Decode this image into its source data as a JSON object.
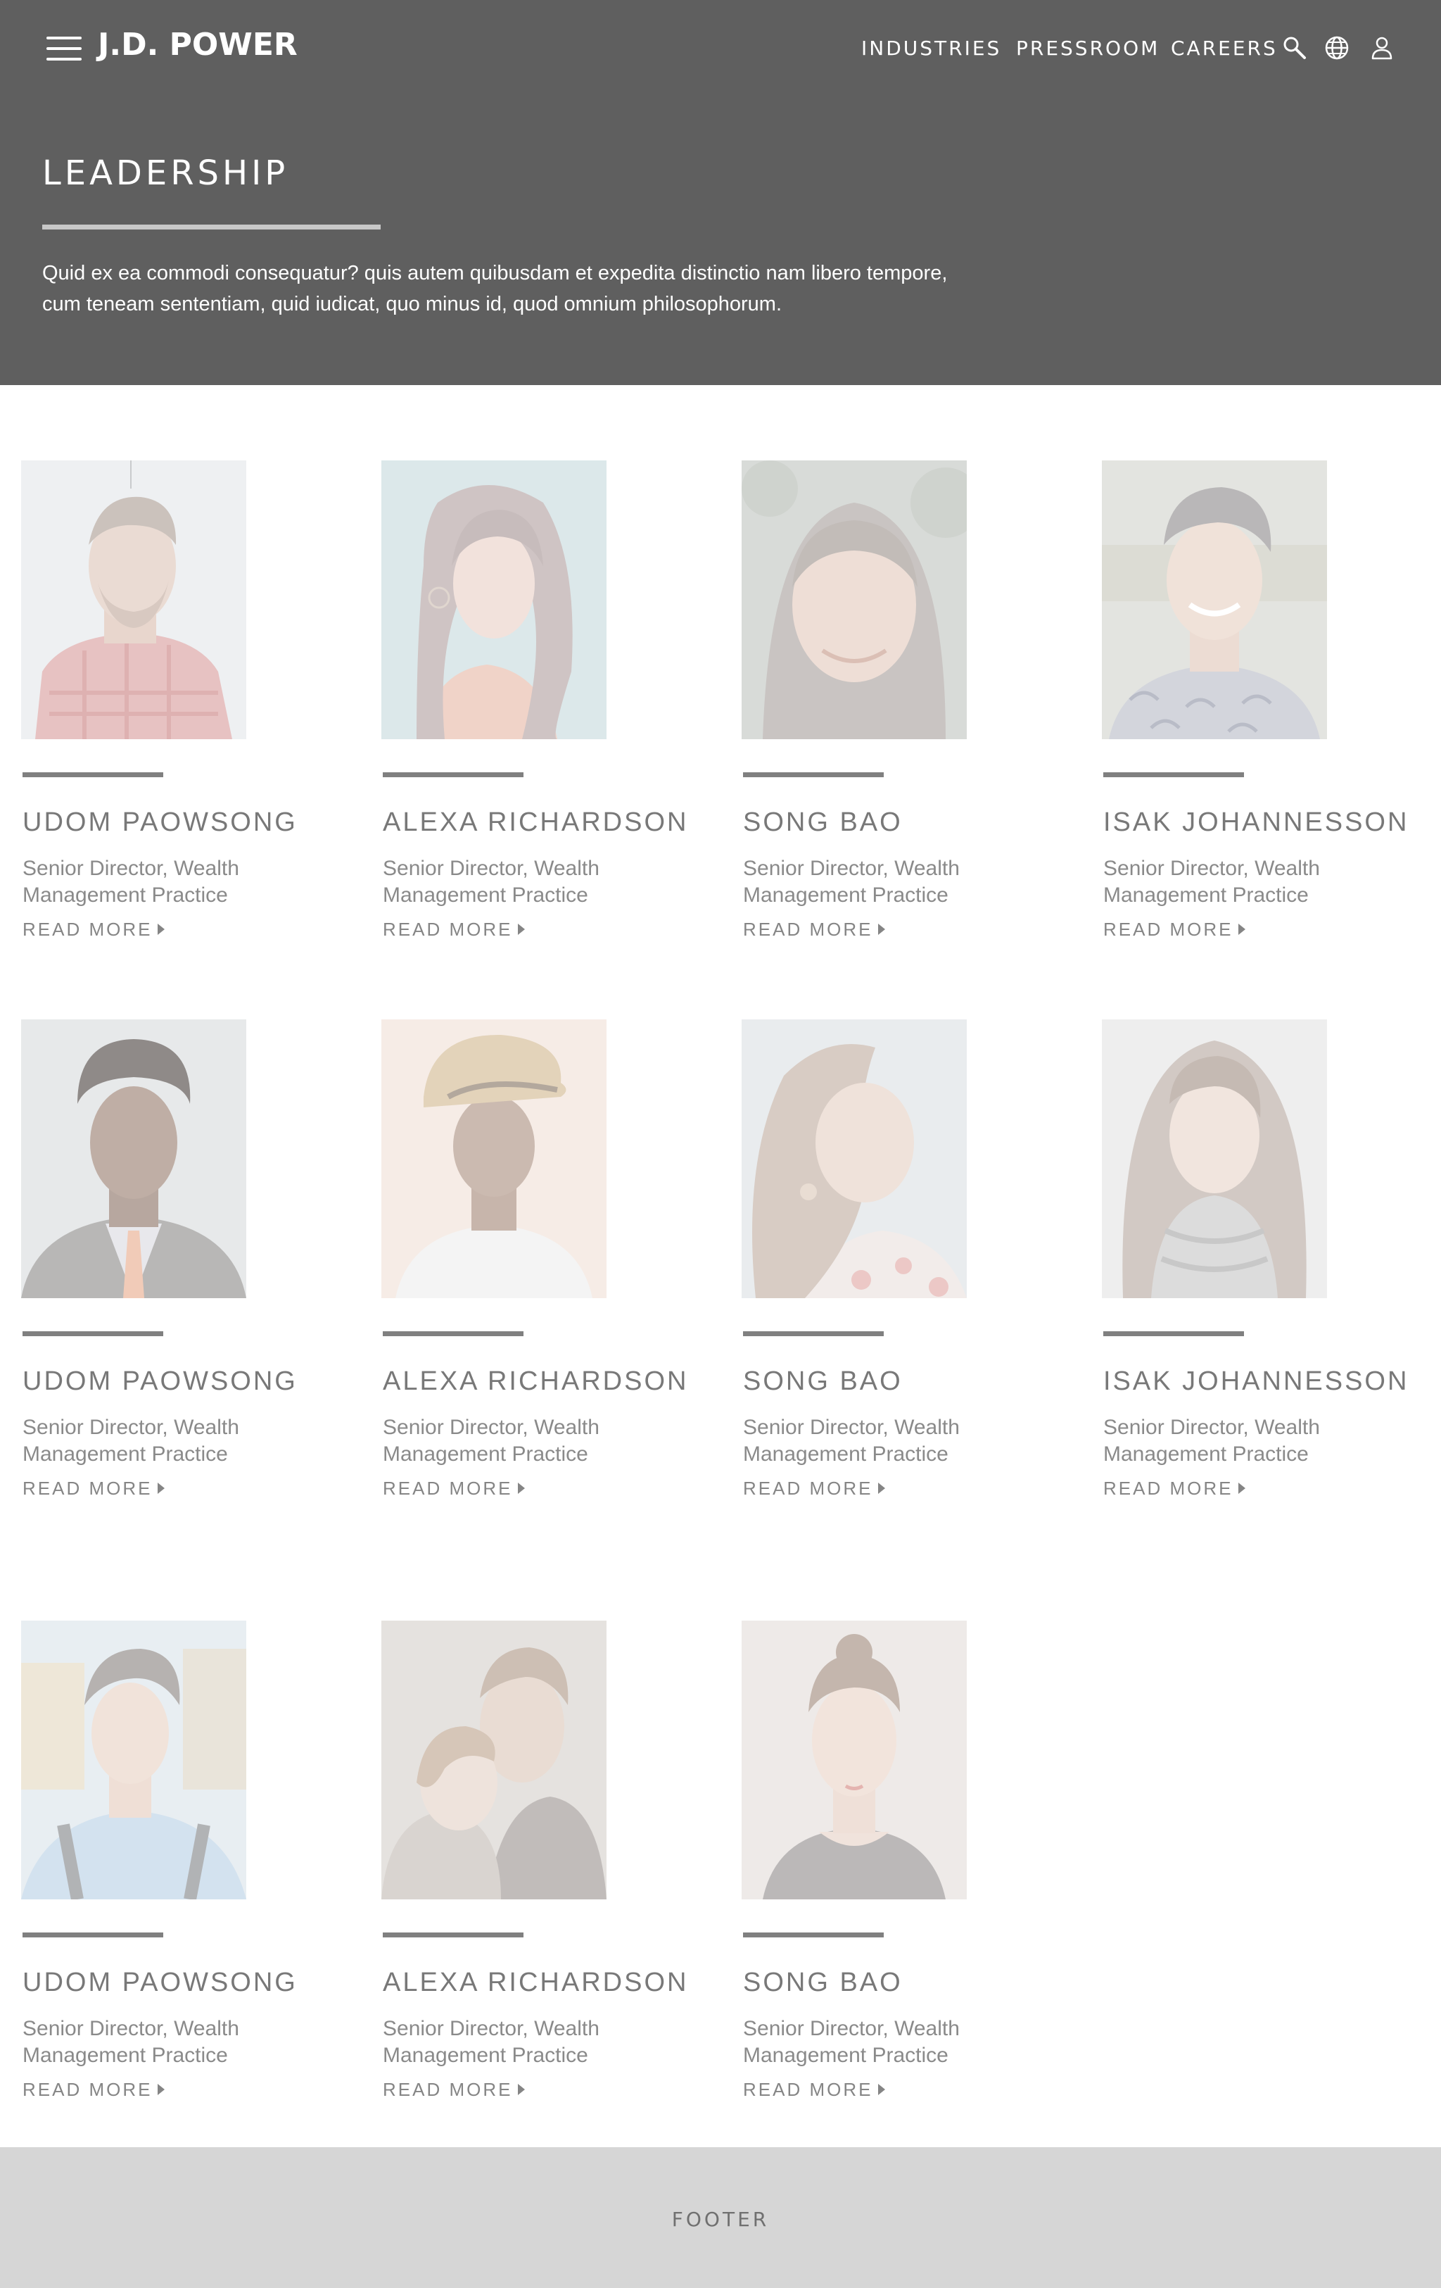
{
  "header": {
    "logo": "J.D. POWER",
    "nav": [
      "INDUSTRIES",
      "PRESSROOM",
      "CAREERS"
    ],
    "icons": [
      "menu-icon",
      "search-icon",
      "globe-icon",
      "user-icon"
    ]
  },
  "hero": {
    "title": "LEADERSHIP",
    "intro": "Quid ex ea commodi consequatur? quis autem quibusdam et expedita distinctio nam libero tempore, cum teneam sententiam, quid iudicat, quo minus id, quod omnium philosophorum."
  },
  "people": [
    {
      "name": "UDOM PAOWSONG",
      "role": "Senior Director, Wealth Management Practice",
      "cta": "READ MORE"
    },
    {
      "name": "ALEXA RICHARDSON",
      "role": "Senior Director, Wealth Management Practice",
      "cta": "READ MORE"
    },
    {
      "name": "SONG BAO",
      "role": "Senior Director, Wealth Management Practice",
      "cta": "READ MORE"
    },
    {
      "name": "ISAK JOHANNESSON",
      "role": "Senior Director, Wealth Management Practice",
      "cta": "READ MORE"
    },
    {
      "name": "UDOM PAOWSONG",
      "role": "Senior Director, Wealth Management Practice",
      "cta": "READ MORE"
    },
    {
      "name": "ALEXA RICHARDSON",
      "role": "Senior Director, Wealth Management Practice",
      "cta": "READ MORE"
    },
    {
      "name": "SONG BAO",
      "role": "Senior Director, Wealth Management Practice",
      "cta": "READ MORE"
    },
    {
      "name": "ISAK JOHANNESSON",
      "role": "Senior Director, Wealth Management Practice",
      "cta": "READ MORE"
    },
    {
      "name": "UDOM PAOWSONG",
      "role": "Senior Director, Wealth Management Practice",
      "cta": "READ MORE"
    },
    {
      "name": "ALEXA RICHARDSON",
      "role": "Senior Director, Wealth Management Practice",
      "cta": "READ MORE"
    },
    {
      "name": "SONG BAO",
      "role": "Senior Director, Wealth Management Practice",
      "cta": "READ MORE"
    }
  ],
  "footer": {
    "label": "FOOTER"
  },
  "colors": {
    "header_bg": "#5f5f5f",
    "footer_bg": "#d6d6d6",
    "rule": "#808080"
  }
}
